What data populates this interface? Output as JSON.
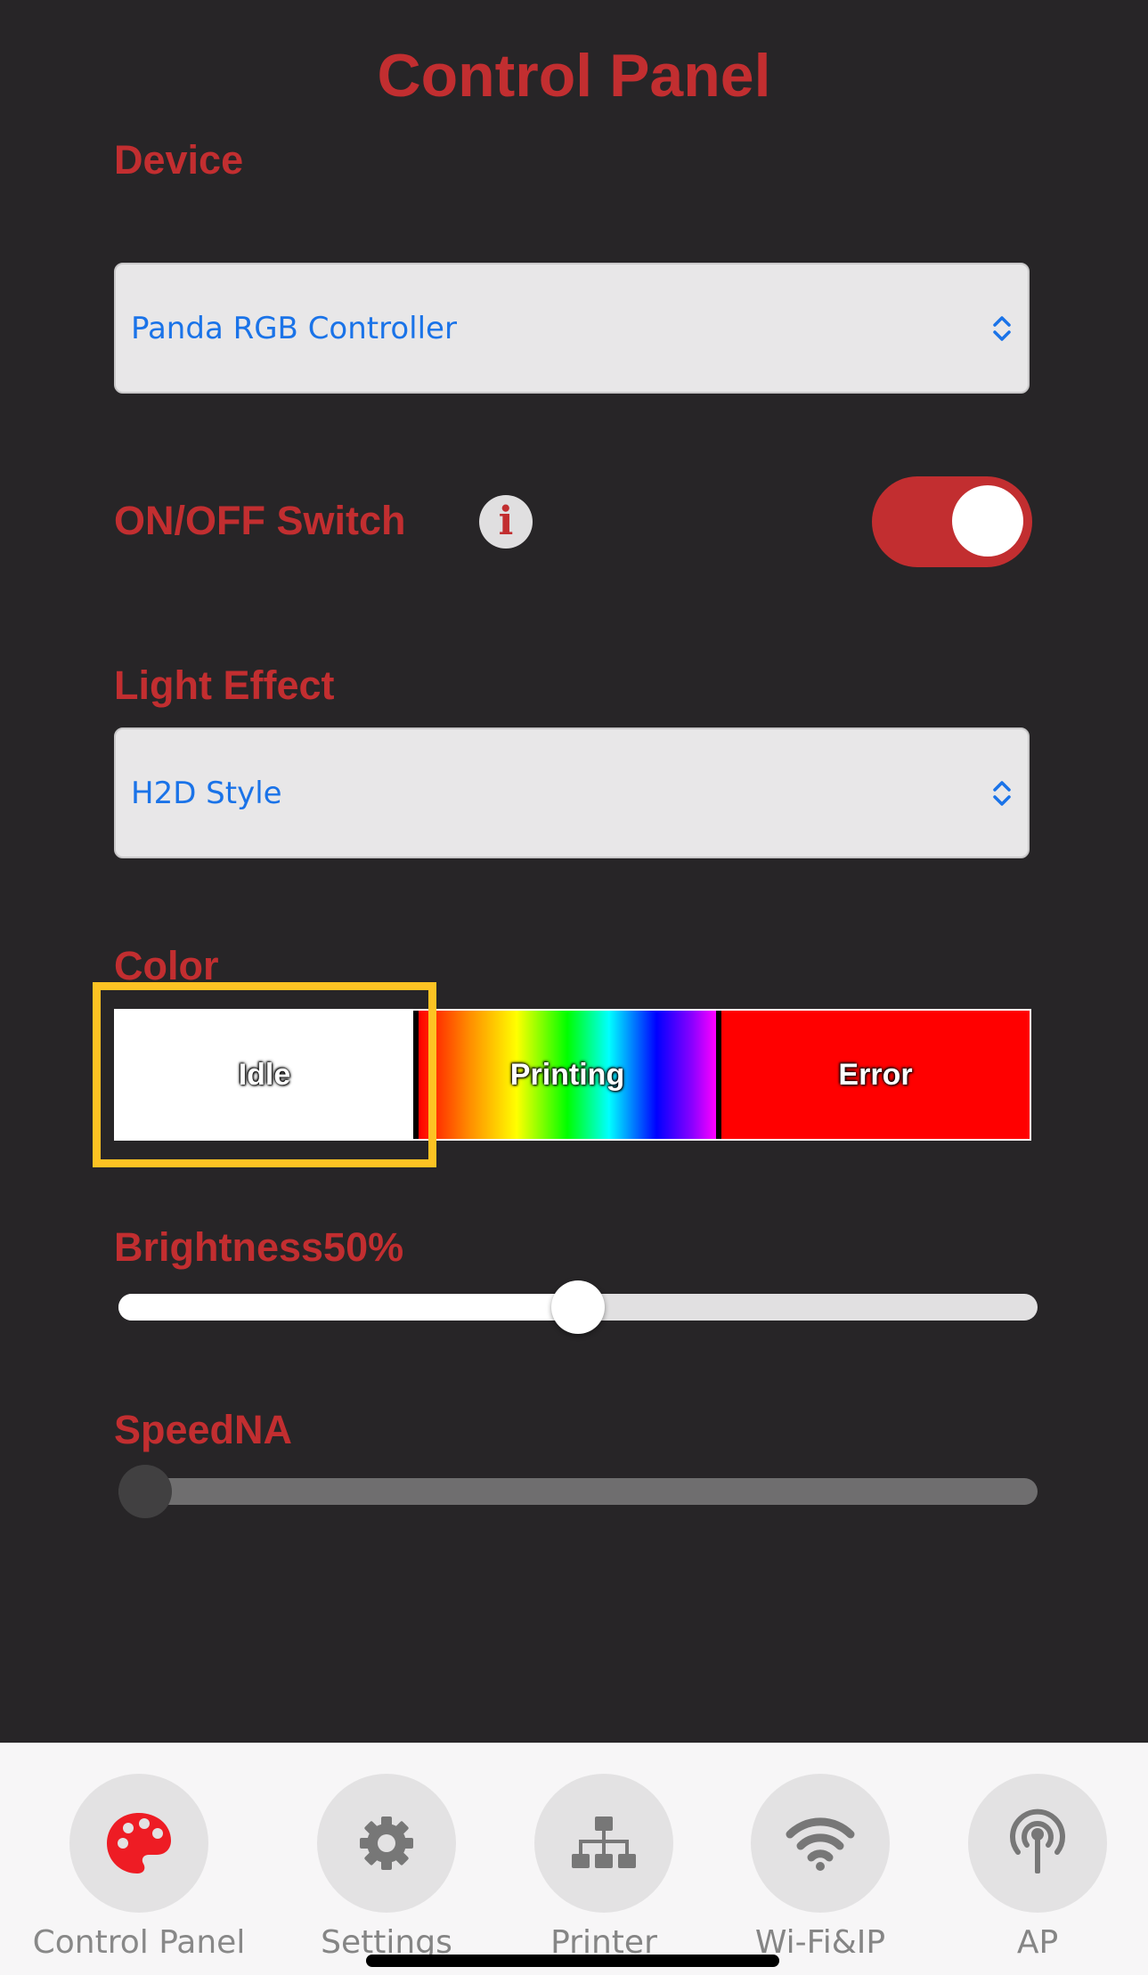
{
  "header": {
    "title": "Control Panel"
  },
  "device": {
    "label": "Device",
    "selected": "Panda RGB Controller"
  },
  "power": {
    "label": "ON/OFF Switch",
    "info_icon": "info-icon",
    "state": "on",
    "accent": "#c22e30"
  },
  "light_effect": {
    "label": "Light Effect",
    "selected": "H2D Style"
  },
  "color": {
    "label": "Color",
    "segments": [
      {
        "label": "Idle",
        "color": "#ffffff",
        "selected": true
      },
      {
        "label": "Printing",
        "color": "rainbow-gradient",
        "selected": false
      },
      {
        "label": "Error",
        "color": "#ff0000",
        "selected": false
      }
    ],
    "selection_color": "#fdc323"
  },
  "brightness": {
    "label": "Brightness50%",
    "value_percent": 50
  },
  "speed": {
    "label": "SpeedNA",
    "value_percent": 0,
    "disabled": true
  },
  "tabs": [
    {
      "label": "Control Panel",
      "icon": "palette-icon",
      "active": true
    },
    {
      "label": "Settings",
      "icon": "gear-icon",
      "active": false
    },
    {
      "label": "Printer",
      "icon": "network-tree-icon",
      "active": false
    },
    {
      "label": "Wi-Fi&IP",
      "icon": "wifi-icon",
      "active": false
    },
    {
      "label": "AP",
      "icon": "antenna-icon",
      "active": false
    }
  ],
  "colors": {
    "background": "#272527",
    "accent_red": "#c22e30",
    "select_value": "#1a73e8",
    "tabbar": "#f7f6f7"
  }
}
